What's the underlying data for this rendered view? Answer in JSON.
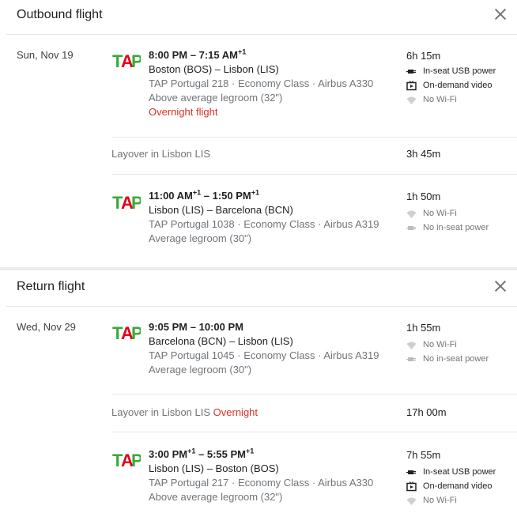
{
  "outbound": {
    "title": "Outbound flight",
    "date": "Sun, Nov 19",
    "segments": [
      {
        "dep": "8:00 PM",
        "sep": " – ",
        "arr": "7:15 AM",
        "arr_sup": "+1",
        "dep_sup": "",
        "route": "Boston (BOS) – Lisbon (LIS)",
        "details": "TAP Portugal 218 · Economy Class · Airbus A330",
        "legroom": "Above average legroom (32\")",
        "overnight": "Overnight flight",
        "duration": "6h 15m",
        "amenities": [
          {
            "icon": "usb-power-icon",
            "label": "In-seat USB power",
            "available": true
          },
          {
            "icon": "video-icon",
            "label": "On-demand video",
            "available": true
          },
          {
            "icon": "wifi-icon",
            "label": "No Wi-Fi",
            "available": false
          }
        ]
      },
      {
        "dep": "11:00 AM",
        "dep_sup": "+1",
        "sep": " – ",
        "arr": "1:50 PM",
        "arr_sup": "+1",
        "route": "Lisbon (LIS) – Barcelona (BCN)",
        "details": "TAP Portugal 1038 · Economy Class · Airbus A319",
        "legroom": "Average legroom (30\")",
        "duration": "1h 50m",
        "amenities": [
          {
            "icon": "wifi-icon",
            "label": "No Wi-Fi",
            "available": false
          },
          {
            "icon": "power-icon",
            "label": "No in-seat power",
            "available": false
          }
        ]
      }
    ],
    "layover": {
      "text": "Layover in Lisbon LIS",
      "extra": "",
      "duration": "3h 45m"
    }
  },
  "return": {
    "title": "Return flight",
    "date": "Wed, Nov 29",
    "segments": [
      {
        "dep": "9:05 PM",
        "dep_sup": "",
        "sep": " – ",
        "arr": "10:00 PM",
        "arr_sup": "",
        "route": "Barcelona (BCN) – Lisbon (LIS)",
        "details": "TAP Portugal 1045 · Economy Class · Airbus A319",
        "legroom": "Average legroom (30\")",
        "duration": "1h 55m",
        "amenities": [
          {
            "icon": "wifi-icon",
            "label": "No Wi-Fi",
            "available": false
          },
          {
            "icon": "power-icon",
            "label": "No in-seat power",
            "available": false
          }
        ]
      },
      {
        "dep": "3:00 PM",
        "dep_sup": "+1",
        "sep": " – ",
        "arr": "5:55 PM",
        "arr_sup": "+1",
        "route": "Lisbon (LIS) – Boston (BOS)",
        "details": "TAP Portugal 217 · Economy Class · Airbus A330",
        "legroom": "Above average legroom (32\")",
        "duration": "7h 55m",
        "amenities": [
          {
            "icon": "usb-power-icon",
            "label": "In-seat USB power",
            "available": true
          },
          {
            "icon": "video-icon",
            "label": "On-demand video",
            "available": true
          },
          {
            "icon": "wifi-icon",
            "label": "No Wi-Fi",
            "available": false
          }
        ]
      }
    ],
    "layover": {
      "text": "Layover in Lisbon LIS",
      "extra": "Overnight",
      "duration": "17h 00m"
    }
  },
  "colors": {
    "tap_green": "#3aaa35",
    "tap_red": "#e3001b",
    "warning_red": "#d93025"
  }
}
